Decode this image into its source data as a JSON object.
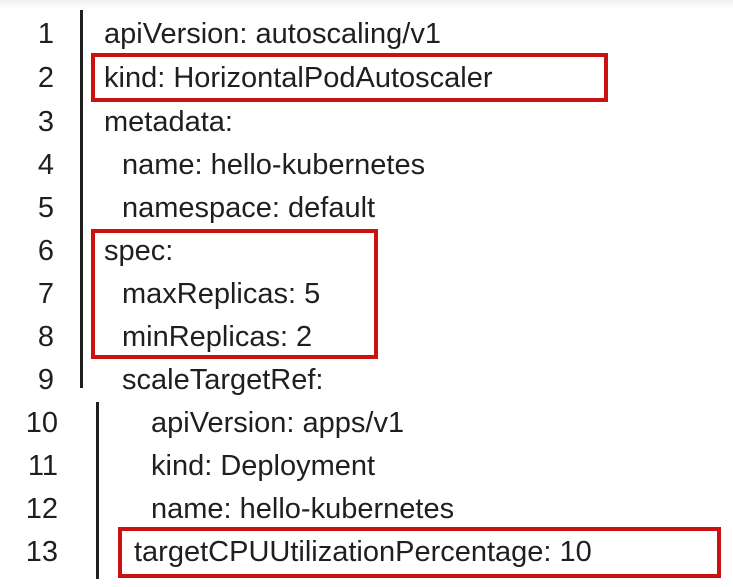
{
  "editor": {
    "lines": [
      {
        "number": "1",
        "text": "apiVersion: autoscaling/v1"
      },
      {
        "number": "2",
        "text": "kind: HorizontalPodAutoscaler"
      },
      {
        "number": "3",
        "text": "metadata:"
      },
      {
        "number": "4",
        "text": "name: hello-kubernetes"
      },
      {
        "number": "5",
        "text": "namespace: default"
      },
      {
        "number": "6",
        "text": "spec:"
      },
      {
        "number": "7",
        "text": "maxReplicas: 5"
      },
      {
        "number": "8",
        "text": "minReplicas: 2"
      },
      {
        "number": "9",
        "text": "scaleTargetRef:"
      },
      {
        "number": "10",
        "text": "apiVersion: apps/v1"
      },
      {
        "number": "11",
        "text": "kind: Deployment"
      },
      {
        "number": "12",
        "text": "name: hello-kubernetes"
      },
      {
        "number": "13",
        "text": "targetCPUUtilizationPercentage: 10"
      }
    ],
    "highlight_color": "#cc1111",
    "text_color": "#1f1f1f",
    "background_color": "#ffffff"
  }
}
